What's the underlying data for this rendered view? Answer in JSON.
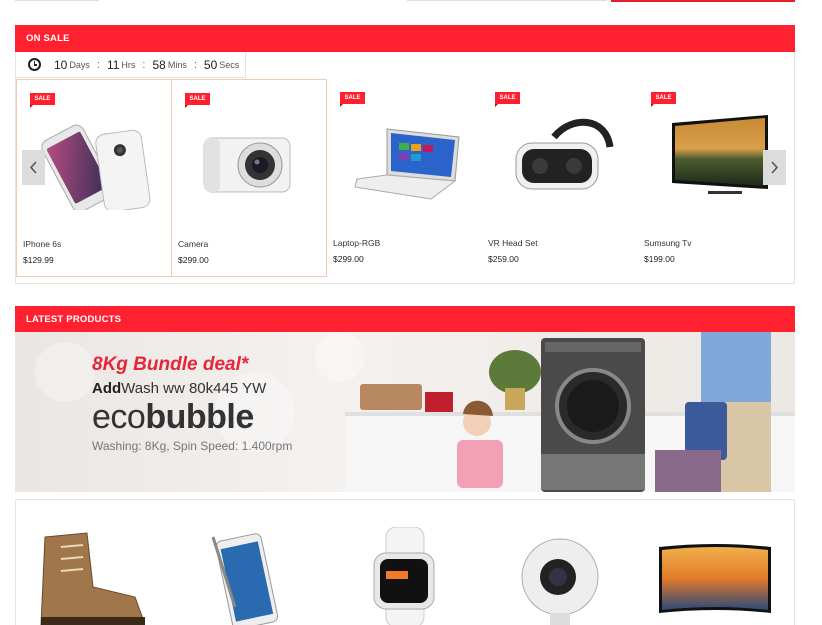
{
  "on_sale": {
    "title": "ON SALE",
    "countdown": {
      "days": "10",
      "days_label": "Days",
      "hours": "11",
      "hours_label": "Hrs",
      "mins": "58",
      "mins_label": "Mins",
      "secs": "50",
      "secs_label": "Secs"
    },
    "badge": "SALE",
    "products": [
      {
        "name": "IPhone 6s",
        "price": "$129.99",
        "icon": "smartphone-image"
      },
      {
        "name": "Camera",
        "price": "$299.00",
        "icon": "camera-image"
      },
      {
        "name": "Laptop-RGB",
        "price": "$299.00",
        "icon": "laptop-image"
      },
      {
        "name": "VR Head Set",
        "price": "$259.00",
        "icon": "vr-headset-image"
      },
      {
        "name": "Sumsung Tv",
        "price": "$199.00",
        "icon": "tv-image"
      }
    ]
  },
  "latest_products": {
    "title": "LATEST PRODUCTS",
    "banner": {
      "deal": "8Kg Bundle deal*",
      "model_bold": "Add",
      "model_rest": "Wash ww 80k445 YW",
      "brand_light": "eco",
      "brand_bold": "bubble",
      "spec": "Washing: 8Kg, Spin Speed: 1.400rpm"
    },
    "products": [
      {
        "icon": "boot-image"
      },
      {
        "icon": "phablet-image"
      },
      {
        "icon": "smartwatch-image"
      },
      {
        "icon": "360-camera-image"
      },
      {
        "icon": "curved-tv-image"
      }
    ]
  },
  "colors": {
    "accent": "#ff2030",
    "highlight_border": "#f5c9b4"
  }
}
